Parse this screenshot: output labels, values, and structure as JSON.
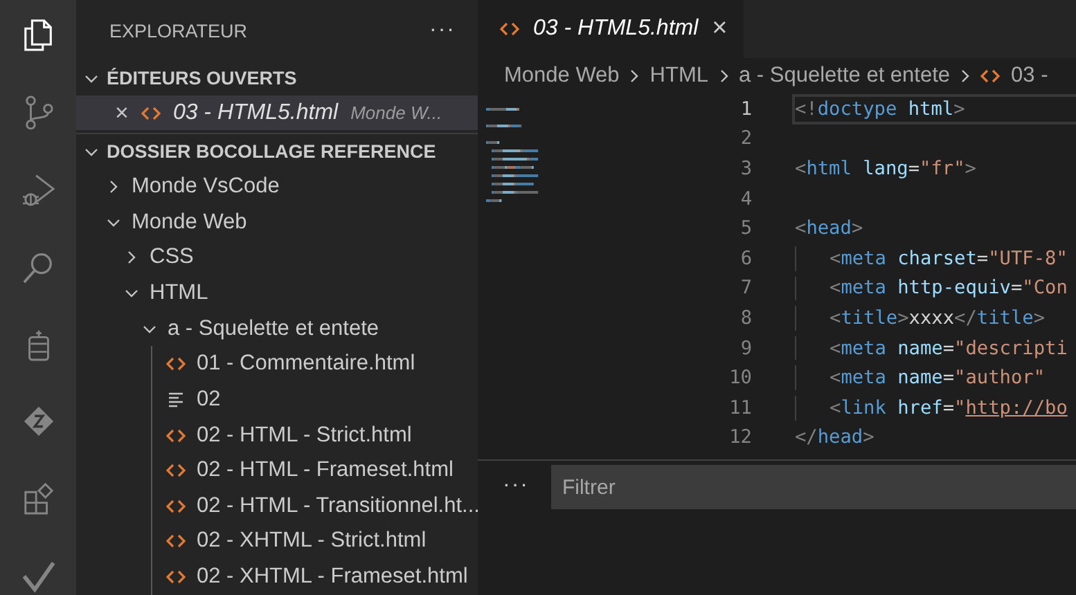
{
  "activity_bar": [
    {
      "kind": "files",
      "selected": true
    },
    {
      "kind": "source-control",
      "selected": false
    },
    {
      "kind": "run-debug",
      "selected": false
    },
    {
      "kind": "search",
      "selected": false
    },
    {
      "kind": "jar",
      "selected": false
    },
    {
      "kind": "diamond",
      "selected": false
    },
    {
      "kind": "extensions",
      "selected": false
    },
    {
      "kind": "check",
      "selected": false
    }
  ],
  "sidebar": {
    "title": "EXPLORATEUR",
    "more": "···",
    "open_editors": {
      "title": "ÉDITEURS OUVERTS",
      "expanded": true,
      "items": [
        {
          "close": "×",
          "kind": "html",
          "name": "03 - HTML5.html",
          "description": "Monde W...",
          "selected": true
        }
      ]
    },
    "folder": {
      "title": "DOSSIER BOCOLLAGE REFERENCE",
      "expanded": true,
      "children": [
        {
          "label": "Monde VsCode",
          "kind": "folder",
          "expanded": false
        },
        {
          "label": "Monde Web",
          "kind": "folder",
          "expanded": true,
          "children": [
            {
              "label": "CSS",
              "kind": "folder",
              "expanded": false
            },
            {
              "label": "HTML",
              "kind": "folder",
              "expanded": true,
              "children": [
                {
                  "label": "a - Squelette et entete",
                  "kind": "folder",
                  "expanded": true,
                  "children": [
                    {
                      "label": "01 - Commentaire.html",
                      "kind": "html"
                    },
                    {
                      "label": "02",
                      "kind": "text"
                    },
                    {
                      "label": "02 - HTML  - Strict.html",
                      "kind": "html"
                    },
                    {
                      "label": "02 - HTML - Frameset.html",
                      "kind": "html"
                    },
                    {
                      "label": "02 - HTML - Transitionnel.ht...",
                      "kind": "html"
                    },
                    {
                      "label": "02 - XHTML  - Strict.html",
                      "kind": "html"
                    },
                    {
                      "label": "02 - XHTML - Frameset.html",
                      "kind": "html"
                    }
                  ]
                }
              ]
            }
          ]
        }
      ]
    }
  },
  "editor": {
    "tabs": [
      {
        "title": "03 - HTML5.html",
        "kind": "html",
        "close": "×",
        "selected": true
      }
    ],
    "breadcrumbs": [
      {
        "label": "Monde Web",
        "kind": "folder"
      },
      {
        "label": "HTML",
        "kind": "folder"
      },
      {
        "label": "a - Squelette et entete",
        "kind": "folder"
      },
      {
        "label": "03 -",
        "kind": "html"
      }
    ],
    "lines": [
      {
        "number": "1",
        "current": true,
        "indented": false,
        "tokens": [
          {
            "kind": "punct",
            "text": "<!"
          },
          {
            "kind": "tag",
            "text": "doctype"
          },
          {
            "kind": "attr",
            "text": " html"
          },
          {
            "kind": "punct",
            "text": ">"
          }
        ]
      },
      {
        "number": "2",
        "current": false,
        "indented": false
      },
      {
        "number": "3",
        "current": false,
        "indented": false,
        "tokens": [
          {
            "kind": "punct",
            "text": "<"
          },
          {
            "kind": "tag",
            "text": "html"
          },
          {
            "kind": "attr",
            "text": " lang"
          },
          {
            "kind": "text",
            "text": "="
          },
          {
            "kind": "string",
            "text": "\"fr\""
          },
          {
            "kind": "punct",
            "text": ">"
          }
        ]
      },
      {
        "number": "4",
        "current": false,
        "indented": false
      },
      {
        "number": "5",
        "current": false,
        "indented": false,
        "tokens": [
          {
            "kind": "punct",
            "text": "<"
          },
          {
            "kind": "tag",
            "text": "head"
          },
          {
            "kind": "punct",
            "text": ">"
          }
        ]
      },
      {
        "number": "6",
        "current": false,
        "indented": true,
        "tokens": [
          {
            "kind": "punct",
            "text": "<"
          },
          {
            "kind": "tag",
            "text": "meta"
          },
          {
            "kind": "attr",
            "text": " charset"
          },
          {
            "kind": "text",
            "text": "="
          },
          {
            "kind": "string",
            "text": "\"UTF-8\""
          }
        ]
      },
      {
        "number": "7",
        "current": false,
        "indented": true,
        "tokens": [
          {
            "kind": "punct",
            "text": "<"
          },
          {
            "kind": "tag",
            "text": "meta"
          },
          {
            "kind": "attr",
            "text": " http-equiv"
          },
          {
            "kind": "text",
            "text": "="
          },
          {
            "kind": "string",
            "text": "\"Con"
          }
        ]
      },
      {
        "number": "8",
        "current": false,
        "indented": true,
        "tokens": [
          {
            "kind": "punct",
            "text": "<"
          },
          {
            "kind": "tag",
            "text": "title"
          },
          {
            "kind": "punct",
            "text": ">"
          },
          {
            "kind": "text",
            "text": "xxxx"
          },
          {
            "kind": "punct",
            "text": "</"
          },
          {
            "kind": "tag",
            "text": "title"
          },
          {
            "kind": "punct",
            "text": ">"
          }
        ]
      },
      {
        "number": "9",
        "current": false,
        "indented": true,
        "tokens": [
          {
            "kind": "punct",
            "text": "<"
          },
          {
            "kind": "tag",
            "text": "meta"
          },
          {
            "kind": "attr",
            "text": " name"
          },
          {
            "kind": "text",
            "text": "="
          },
          {
            "kind": "string",
            "text": "\"descripti"
          }
        ]
      },
      {
        "number": "10",
        "current": false,
        "indented": true,
        "tokens": [
          {
            "kind": "punct",
            "text": "<"
          },
          {
            "kind": "tag",
            "text": "meta"
          },
          {
            "kind": "attr",
            "text": " name"
          },
          {
            "kind": "text",
            "text": "="
          },
          {
            "kind": "string",
            "text": "\"author\""
          }
        ]
      },
      {
        "number": "11",
        "current": false,
        "indented": true,
        "tokens": [
          {
            "kind": "punct",
            "text": "<"
          },
          {
            "kind": "tag",
            "text": "link"
          },
          {
            "kind": "attr",
            "text": " href"
          },
          {
            "kind": "text",
            "text": "="
          },
          {
            "kind": "string",
            "text": "\""
          },
          {
            "kind": "link",
            "text": "http://bo"
          }
        ]
      },
      {
        "number": "12",
        "current": false,
        "indented": false,
        "tokens": [
          {
            "kind": "punct",
            "text": "</"
          },
          {
            "kind": "tag",
            "text": "head"
          },
          {
            "kind": "punct",
            "text": ">"
          }
        ]
      }
    ]
  },
  "panel": {
    "more": "···",
    "filter": {
      "placeholder": "Filtrer"
    }
  }
}
